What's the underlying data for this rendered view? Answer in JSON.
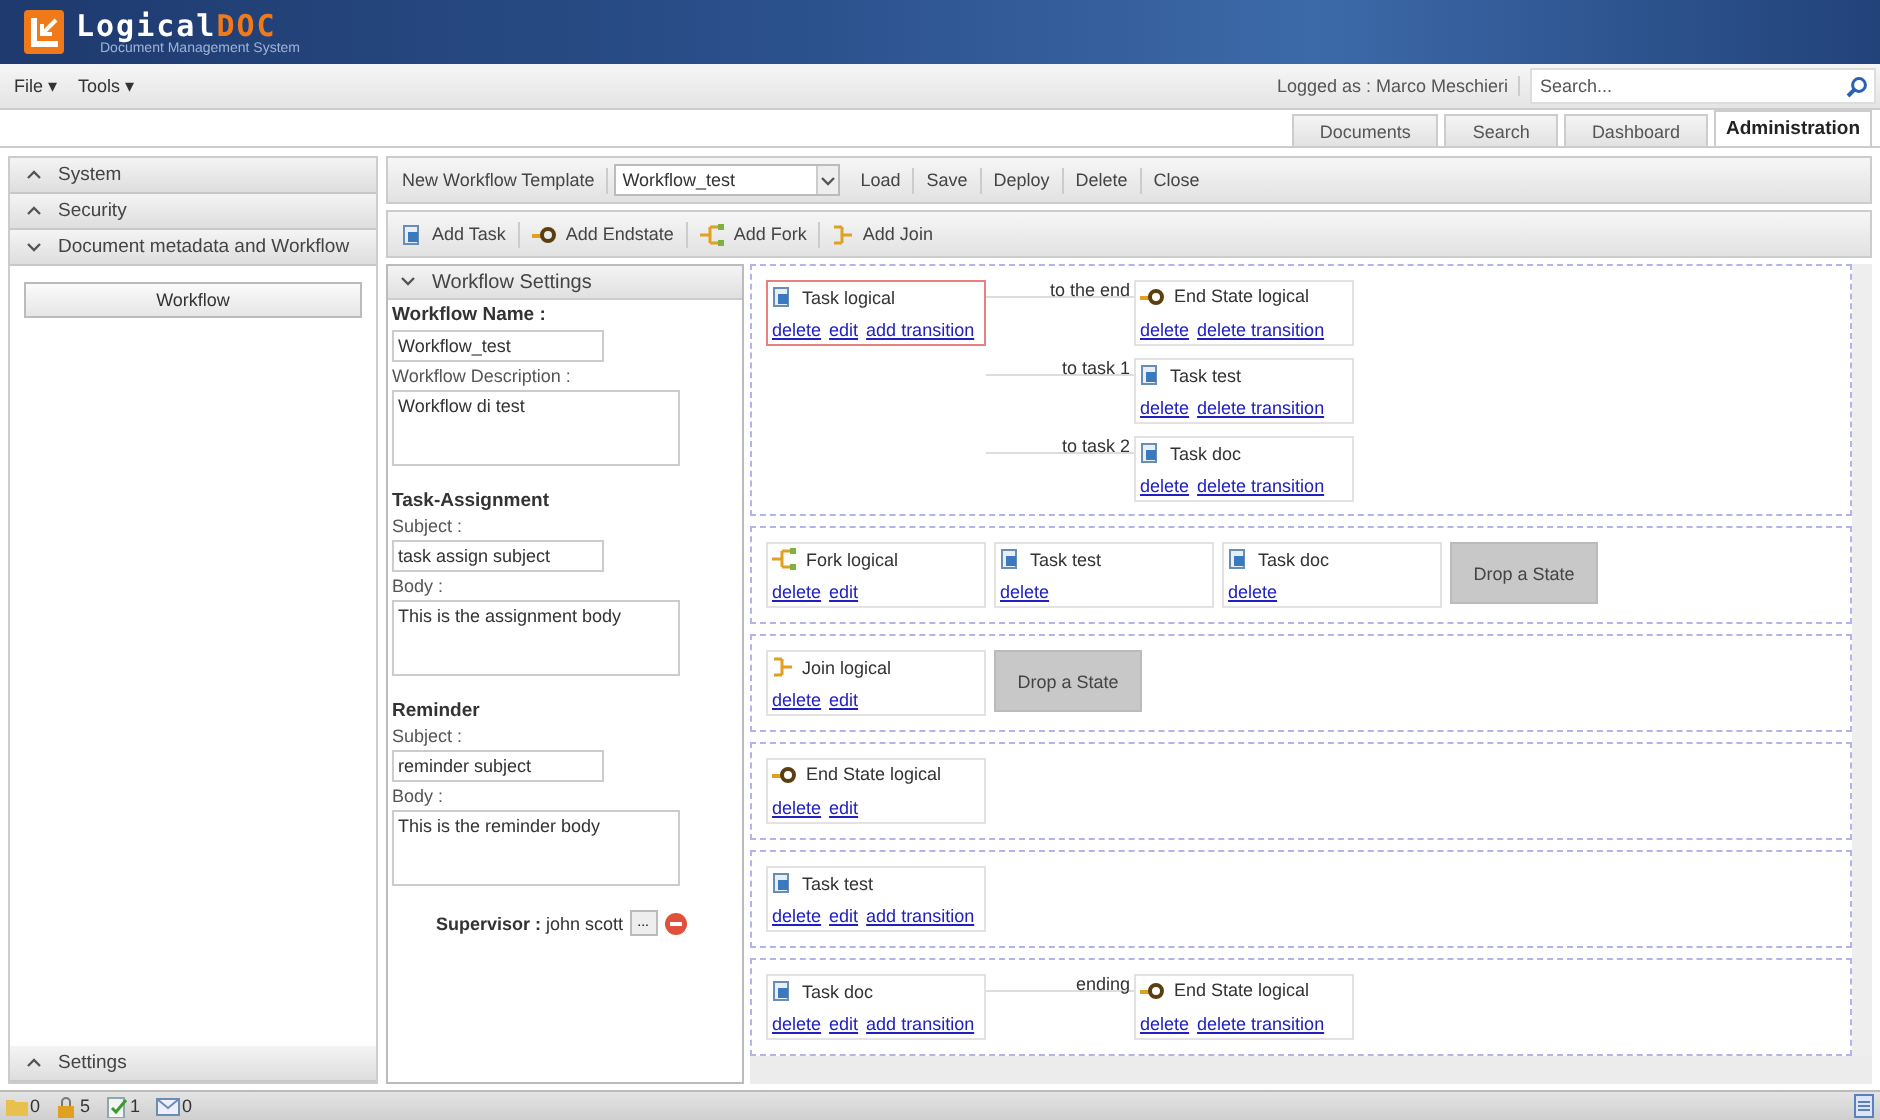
{
  "header": {
    "logo_main": "Logical",
    "logo_accent": "DOC",
    "tagline": "Document Management System"
  },
  "menu": [
    {
      "label": "File",
      "caret": "▾"
    },
    {
      "label": "Tools",
      "caret": "▾"
    }
  ],
  "user": {
    "label": "Logged as :",
    "name": "Marco Meschieri"
  },
  "search": {
    "placeholder": "Search..."
  },
  "tabs": [
    {
      "label": "Documents",
      "selected": false
    },
    {
      "label": "Search",
      "selected": false
    },
    {
      "label": "Dashboard",
      "selected": false
    },
    {
      "label": "Administration",
      "selected": true
    }
  ],
  "sidebar": {
    "sections": [
      {
        "label": "System",
        "expanded": false
      },
      {
        "label": "Security",
        "expanded": false
      },
      {
        "label": "Document metadata and Workflow",
        "expanded": true,
        "items": [
          "Workflow"
        ]
      }
    ],
    "footer": {
      "label": "Settings",
      "expanded": false
    }
  },
  "toolbar": {
    "new": "New Workflow Template",
    "template": "Workflow_test",
    "actions": [
      "Load",
      "Save",
      "Deploy",
      "Delete",
      "Close"
    ]
  },
  "palette": [
    {
      "kind": "task",
      "label": "Add Task"
    },
    {
      "kind": "end",
      "label": "Add Endstate"
    },
    {
      "kind": "fork",
      "label": "Add Fork"
    },
    {
      "kind": "join",
      "label": "Add Join"
    }
  ],
  "settings": {
    "title": "Workflow Settings",
    "expanded": true,
    "name_label": "Workflow Name :",
    "name": "Workflow_test",
    "description_label": "Workflow Description :",
    "description": "Workflow di test",
    "groups": [
      {
        "title": "Task-Assignment",
        "subject_label": "Subject :",
        "subject": "task assign subject",
        "body_label": "Body :",
        "body": "This is the assignment body"
      },
      {
        "title": "Reminder",
        "subject_label": "Subject :",
        "subject": "reminder subject",
        "body_label": "Body :",
        "body": "This is the reminder body"
      }
    ],
    "supervisor_label": "Supervisor :",
    "supervisor": "john scott",
    "browse": "..."
  },
  "canvas": {
    "rows": [
      {
        "nodes": [
          {
            "kind": "task",
            "name": "Task logical",
            "selected": true,
            "links": [
              "delete",
              "edit",
              "add transition"
            ],
            "transitions": [
              {
                "label": "to the end",
                "target": {
                  "kind": "end",
                  "name": "End State logical",
                  "links": [
                    "delete",
                    "delete transition"
                  ]
                }
              },
              {
                "label": "to task 1",
                "target": {
                  "kind": "task",
                  "name": "Task test",
                  "links": [
                    "delete",
                    "delete transition"
                  ]
                }
              },
              {
                "label": "to task 2",
                "target": {
                  "kind": "task",
                  "name": "Task doc",
                  "links": [
                    "delete",
                    "delete transition"
                  ]
                }
              }
            ]
          }
        ]
      },
      {
        "nodes": [
          {
            "kind": "fork",
            "name": "Fork logical",
            "selected": false,
            "links": [
              "delete",
              "edit"
            ]
          },
          {
            "kind": "task",
            "name": "Task test",
            "selected": false,
            "links": [
              "delete"
            ]
          },
          {
            "kind": "task",
            "name": "Task doc",
            "selected": false,
            "links": [
              "delete"
            ]
          }
        ],
        "drop_zone": "Drop a State"
      },
      {
        "nodes": [
          {
            "kind": "join",
            "name": "Join logical",
            "selected": false,
            "links": [
              "delete",
              "edit"
            ]
          }
        ],
        "drop_zone": "Drop a State"
      },
      {
        "nodes": [
          {
            "kind": "end",
            "name": "End State logical",
            "selected": false,
            "links": [
              "delete",
              "edit"
            ]
          }
        ]
      },
      {
        "nodes": [
          {
            "kind": "task",
            "name": "Task test",
            "selected": false,
            "links": [
              "delete",
              "edit",
              "add transition"
            ]
          }
        ]
      },
      {
        "nodes": [
          {
            "kind": "task",
            "name": "Task doc",
            "selected": false,
            "links": [
              "delete",
              "edit",
              "add transition"
            ],
            "transitions": [
              {
                "label": "ending",
                "target": {
                  "kind": "end",
                  "name": "End State logical",
                  "links": [
                    "delete",
                    "delete transition"
                  ]
                }
              }
            ]
          }
        ]
      }
    ]
  },
  "status_bar": [
    {
      "kind": "folder",
      "count": "0"
    },
    {
      "kind": "lock",
      "count": "5"
    },
    {
      "kind": "checked",
      "count": "1"
    },
    {
      "kind": "mail",
      "count": "0"
    }
  ]
}
